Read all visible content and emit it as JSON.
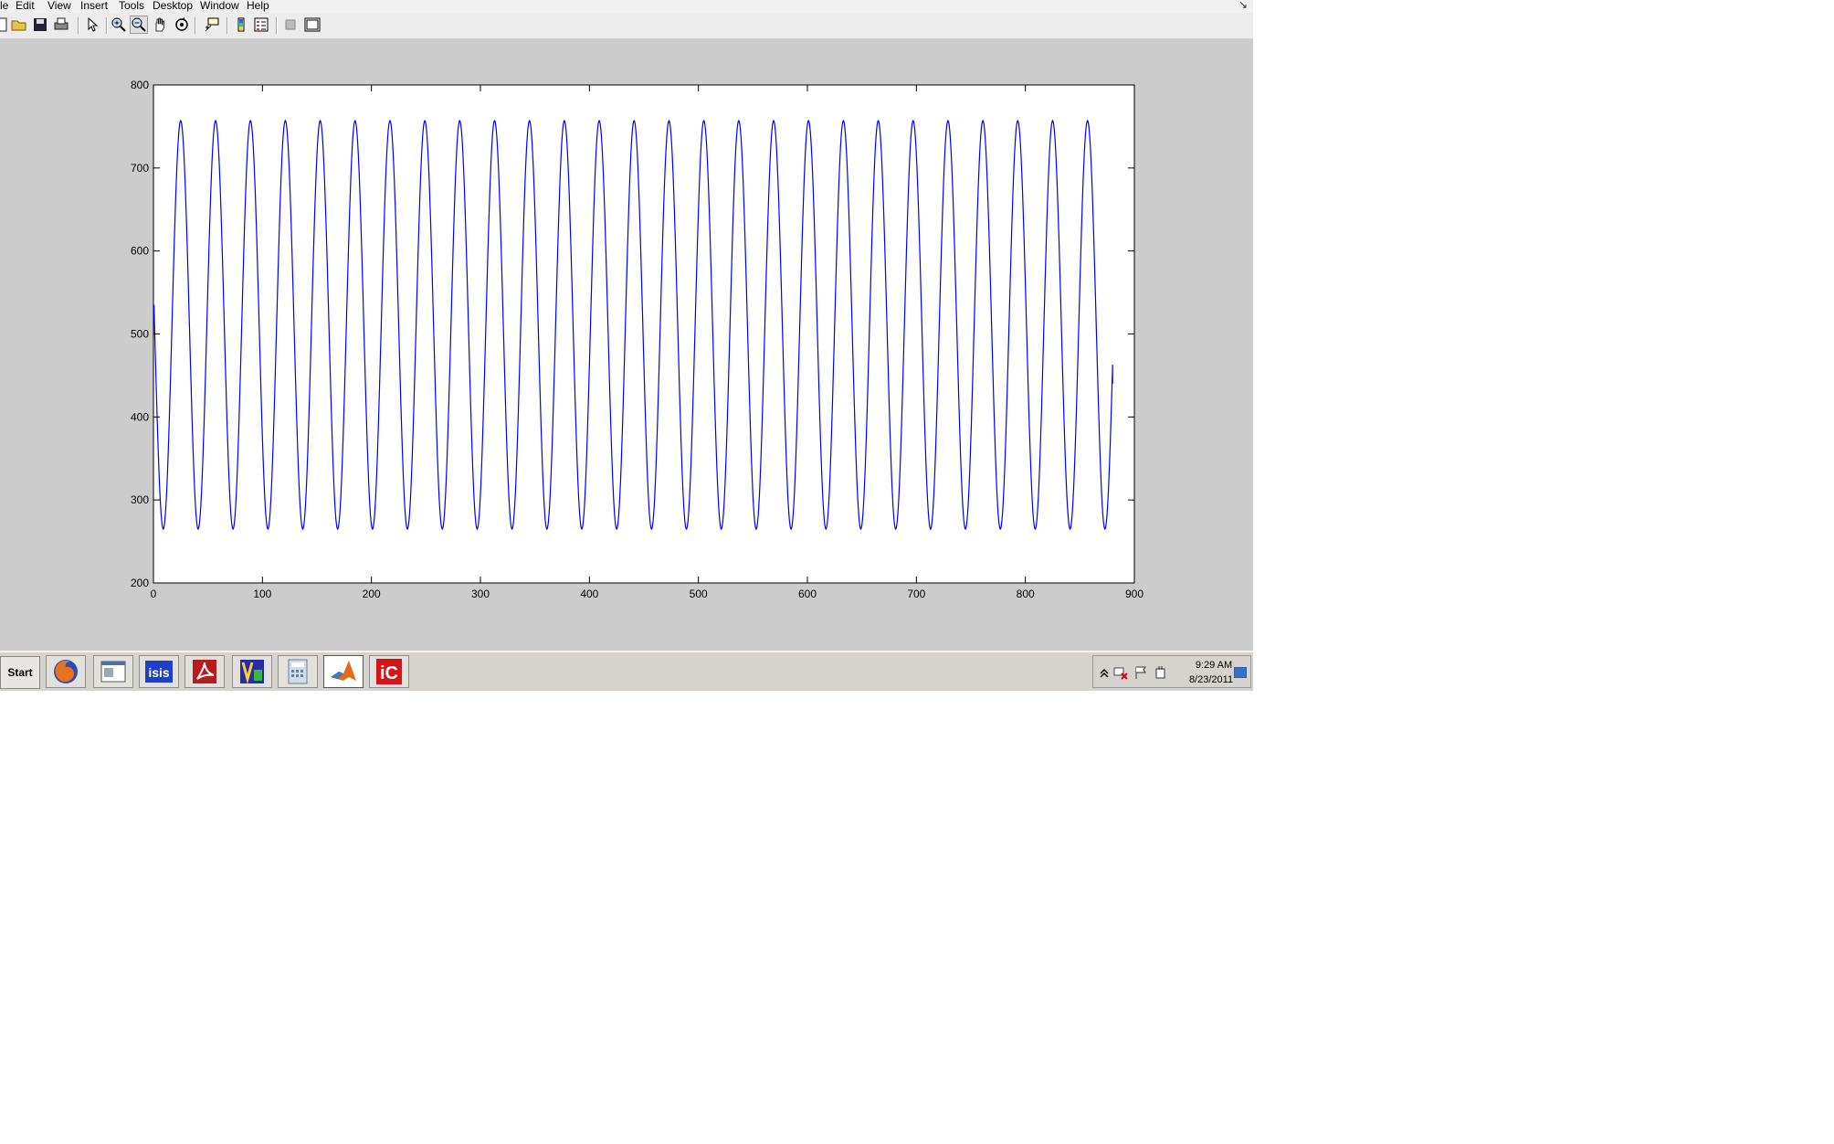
{
  "menu": {
    "items": [
      "le",
      "Edit",
      "View",
      "Insert",
      "Tools",
      "Desktop",
      "Window",
      "Help"
    ]
  },
  "toolbar": {
    "icons": [
      "new-figure-icon",
      "open-file-icon",
      "save-icon",
      "print-icon",
      "select-arrow-icon",
      "zoom-in-icon",
      "zoom-out-icon",
      "pan-hand-icon",
      "rotate-3d-icon",
      "data-cursor-icon",
      "insert-colorbar-icon",
      "insert-legend-icon",
      "hide-plot-tools-icon",
      "show-plot-tools-icon"
    ],
    "pressed": "zoom-out-icon"
  },
  "chart_data": {
    "type": "line",
    "title": "",
    "xlabel": "",
    "ylabel": "",
    "xlim": [
      0,
      900
    ],
    "ylim": [
      200,
      800
    ],
    "xticks": [
      0,
      100,
      200,
      300,
      400,
      500,
      600,
      700,
      800,
      900
    ],
    "yticks": [
      200,
      300,
      400,
      500,
      600,
      700,
      800
    ],
    "grid": false,
    "line_color": "#0000ff",
    "series": [
      {
        "start_value": 512,
        "x_end": 880,
        "y_end": 440,
        "min": 265,
        "max": 757,
        "period": 32,
        "phase_peak_x": 25
      }
    ]
  },
  "taskbar": {
    "start_label": "Start",
    "tasks": [
      {
        "name": "firefox-icon"
      },
      {
        "name": "window-app-icon"
      },
      {
        "name": "isis-icon",
        "label": "isis"
      },
      {
        "name": "acrobat-icon"
      },
      {
        "name": "vb-icon"
      },
      {
        "name": "calculator-icon"
      },
      {
        "name": "matlab-icon",
        "active": true
      },
      {
        "name": "iconic-app-icon",
        "label": "iC"
      }
    ],
    "tray": {
      "time": "9:29 AM",
      "date": "8/23/2011"
    }
  }
}
